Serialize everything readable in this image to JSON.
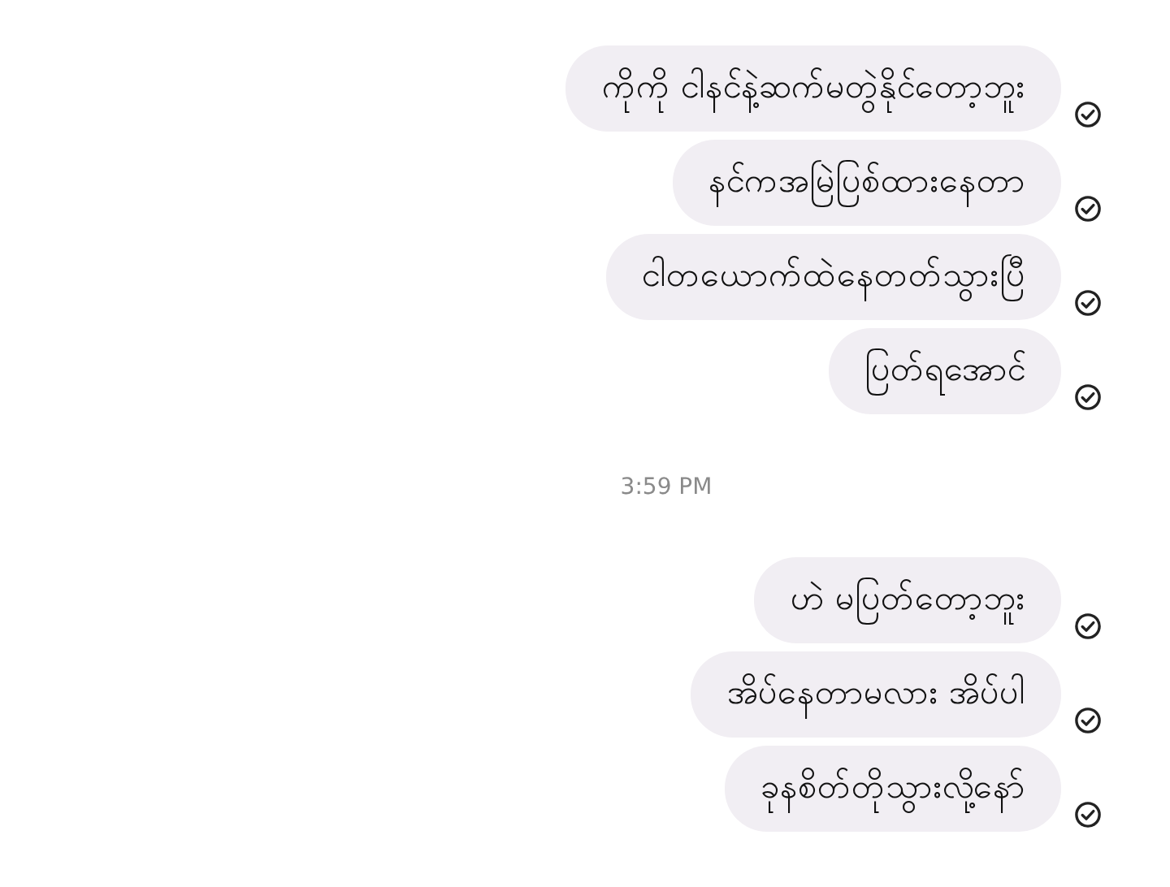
{
  "conversation": [
    {
      "kind": "message",
      "text": "ကိုကို ငါနင်နဲ့ဆက်မတွဲနိုင်တော့ဘူး"
    },
    {
      "kind": "message",
      "text": "နင်ကအမြဲပြစ်ထားနေတာ"
    },
    {
      "kind": "message",
      "text": "ငါတယောက်ထဲနေတတ်သွားပြီ"
    },
    {
      "kind": "message",
      "text": "ပြတ်ရအောင်"
    },
    {
      "kind": "timestamp",
      "text": "3:59 PM"
    },
    {
      "kind": "message",
      "text": "ဟဲ မပြတ်တော့ဘူး"
    },
    {
      "kind": "message",
      "text": "အိပ်နေတာမလား အိပ်ပါ"
    },
    {
      "kind": "message",
      "text": "ခုနစိတ်တိုသွားလို့နော်"
    }
  ]
}
